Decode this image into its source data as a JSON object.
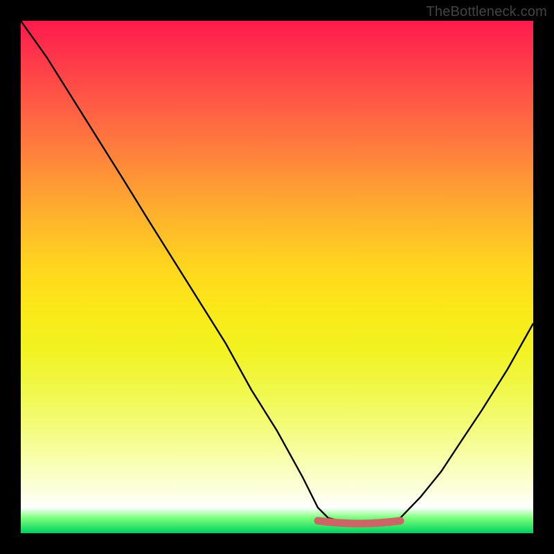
{
  "watermark": "TheBottleneck.com",
  "chart_data": {
    "type": "line",
    "title": "",
    "xlabel": "",
    "ylabel": "",
    "xlim": [
      0,
      1
    ],
    "ylim": [
      0,
      1
    ],
    "series": [
      {
        "name": "curve",
        "x": [
          0.0,
          0.05,
          0.1,
          0.15,
          0.2,
          0.25,
          0.3,
          0.35,
          0.4,
          0.45,
          0.5,
          0.55,
          0.58,
          0.6,
          0.64,
          0.68,
          0.72,
          0.74,
          0.78,
          0.82,
          0.86,
          0.9,
          0.95,
          1.0
        ],
        "y": [
          1.0,
          0.93,
          0.85,
          0.77,
          0.69,
          0.61,
          0.53,
          0.45,
          0.37,
          0.28,
          0.2,
          0.11,
          0.05,
          0.03,
          0.02,
          0.02,
          0.02,
          0.03,
          0.07,
          0.12,
          0.18,
          0.24,
          0.32,
          0.41
        ]
      },
      {
        "name": "flat-band",
        "x": [
          0.58,
          0.74
        ],
        "y": [
          0.025,
          0.025
        ]
      }
    ],
    "colors": {
      "gradient_top": "#ff1a4d",
      "gradient_mid": "#ffd61e",
      "gradient_bottom": "#00d060",
      "curve": "#000000",
      "flat_band": "#cc6666"
    }
  }
}
